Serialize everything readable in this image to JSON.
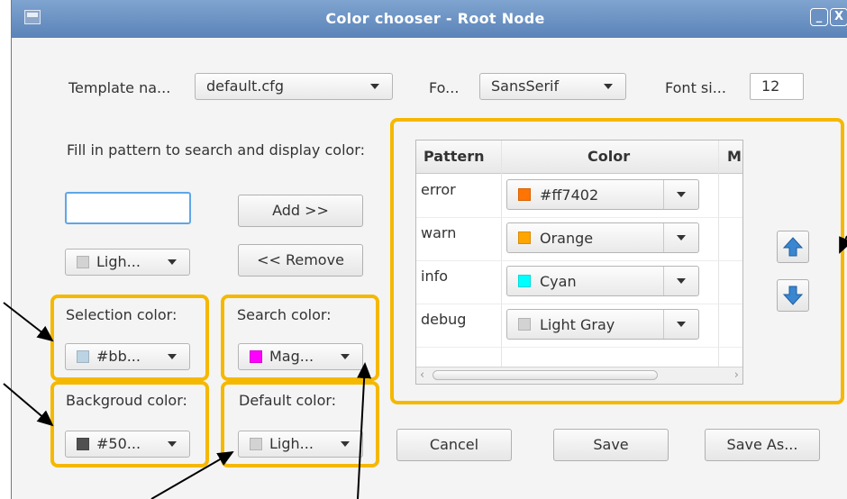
{
  "window": {
    "title": "Color chooser - Root Node",
    "minimize_glyph": "_",
    "close_glyph": "X"
  },
  "template": {
    "label": "Template na...",
    "value": "default.cfg"
  },
  "font": {
    "label": "Fo...",
    "value": "SansSerif"
  },
  "font_size": {
    "label": "Font si...",
    "value": "12"
  },
  "pattern_hint": "Fill in pattern to search and display color:",
  "pattern_input": {
    "value": ""
  },
  "add_button": "Add >>",
  "remove_button": "<< Remove",
  "new_color_combo": {
    "value": "Ligh...",
    "swatch": "#d3d3d3"
  },
  "selection": {
    "label": "Selection color:",
    "value": "#bb...",
    "swatch": "#bbd3e3"
  },
  "search": {
    "label": "Search color:",
    "value": "Mag...",
    "swatch": "#ff00ff"
  },
  "background": {
    "label": "Backgroud color:",
    "value": "#50...",
    "swatch": "#505050"
  },
  "default": {
    "label": "Default color:",
    "value": "Ligh...",
    "swatch": "#d3d3d3"
  },
  "table": {
    "columns": [
      "Pattern",
      "Color",
      "M"
    ],
    "rows": [
      {
        "pattern": "error",
        "color": "#ff7402",
        "swatch": "#ff7402"
      },
      {
        "pattern": "warn",
        "color": "Orange",
        "swatch": "#ffa500"
      },
      {
        "pattern": "info",
        "color": "Cyan",
        "swatch": "#00ffff"
      },
      {
        "pattern": "debug",
        "color": "Light Gray",
        "swatch": "#d3d3d3"
      }
    ]
  },
  "move_up_icon": "arrow-up-icon",
  "move_down_icon": "arrow-down-icon",
  "buttons": {
    "cancel": "Cancel",
    "save": "Save",
    "save_as": "Save As..."
  },
  "colors": {
    "highlight": "#f5b800",
    "titlebar": "#6b8fc0",
    "arrow_blue": "#3a86d0"
  }
}
